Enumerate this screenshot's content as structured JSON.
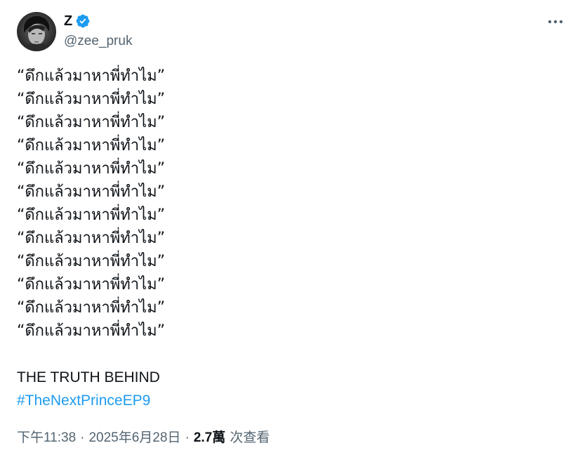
{
  "author": {
    "display_name": "Z",
    "handle": "@zee_pruk",
    "verified": true
  },
  "tweet": {
    "lines": [
      "“ดึกแล้วมาหาพี่ทำไม”",
      "“ดึกแล้วมาหาพี่ทำไม”",
      "“ดึกแล้วมาหาพี่ทำไม”",
      "“ดึกแล้วมาหาพี่ทำไม”",
      "“ดึกแล้วมาหาพี่ทำไม”",
      "“ดึกแล้วมาหาพี่ทำไม”",
      "“ดึกแล้วมาหาพี่ทำไม”",
      "“ดึกแล้วมาหาพี่ทำไม”",
      "“ดึกแล้วมาหาพี่ทำไม”",
      "“ดึกแล้วมาหาพี่ทำไม”",
      "“ดึกแล้วมาหาพี่ทำไม”",
      "“ดึกแล้วมาหาพี่ทำไม”"
    ],
    "tagline": "THE TRUTH BEHIND",
    "hashtag": "#TheNextPrinceEP9"
  },
  "meta": {
    "time": "下午11:38",
    "separator": "·",
    "date": "2025年6月28日",
    "views_count": "2.7萬",
    "views_label": "次查看"
  },
  "icons": {
    "verified": "verified-badge-icon",
    "more": "more-options-icon"
  },
  "colors": {
    "accent": "#1d9bf0",
    "text": "#0f1419",
    "secondary": "#536471"
  }
}
